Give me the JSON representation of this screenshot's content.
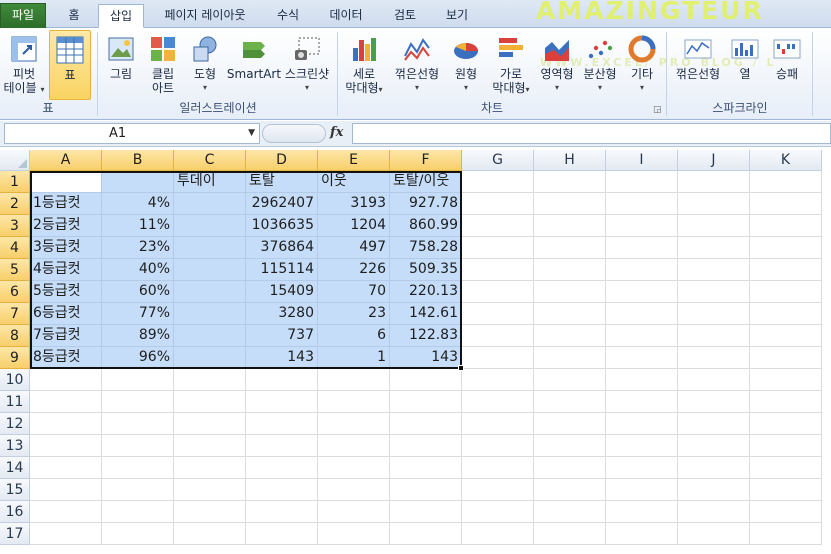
{
  "tabs": [
    "파일",
    "홈",
    "삽입",
    "페이지 레이아웃",
    "수식",
    "데이터",
    "검토",
    "보기"
  ],
  "active_tab": "삽입",
  "watermark": {
    "line1": "AMAZINGTEUR",
    "line2": "WWW.EXCEL/ PRO BLOG / L"
  },
  "ribbon": {
    "groups": {
      "table": "표",
      "illustrations": "일러스트레이션",
      "charts": "차트",
      "sparklines": "스파크라인"
    },
    "buttons": {
      "pivot_table": [
        "피벗",
        "테이블"
      ],
      "table": "표",
      "picture": "그림",
      "clip_art": [
        "클립",
        "아트"
      ],
      "shapes": "도형",
      "smartart": "SmartArt",
      "screenshot": "스크린샷",
      "column": [
        "세로",
        "막대형"
      ],
      "line": "꺾은선형",
      "pie": "원형",
      "bar": [
        "가로",
        "막대형"
      ],
      "area": "영역형",
      "scatter": "분산형",
      "other": "기타",
      "spark_line": "꺾은선형",
      "spark_column": "열",
      "spark_winloss": "승패"
    },
    "accent": "#f9d462"
  },
  "formula_bar": {
    "name_box": "A1",
    "fx": "fx",
    "content": ""
  },
  "sheet": {
    "columns": [
      "A",
      "B",
      "C",
      "D",
      "E",
      "F",
      "G",
      "H",
      "I",
      "J",
      "K"
    ],
    "rows": [
      "1",
      "2",
      "3",
      "4",
      "5",
      "6",
      "7",
      "8",
      "9",
      "10",
      "11",
      "12",
      "13",
      "14",
      "15",
      "16",
      "17"
    ],
    "selection_color": "#c5ddf8",
    "cells": [
      [
        "",
        "",
        "투데이",
        "토탈",
        "이웃",
        "토탈/이웃"
      ],
      [
        "1등급컷",
        "4%",
        "",
        "2962407",
        "3193",
        "927.78"
      ],
      [
        "2등급컷",
        "11%",
        "",
        "1036635",
        "1204",
        "860.99"
      ],
      [
        "3등급컷",
        "23%",
        "",
        "376864",
        "497",
        "758.28"
      ],
      [
        "4등급컷",
        "40%",
        "",
        "115114",
        "226",
        "509.35"
      ],
      [
        "5등급컷",
        "60%",
        "",
        "15409",
        "70",
        "220.13"
      ],
      [
        "6등급컷",
        "77%",
        "",
        "3280",
        "23",
        "142.61"
      ],
      [
        "7등급컷",
        "89%",
        "",
        "737",
        "6",
        "122.83"
      ],
      [
        "8등급컷",
        "96%",
        "",
        "143",
        "1",
        "143"
      ]
    ]
  }
}
